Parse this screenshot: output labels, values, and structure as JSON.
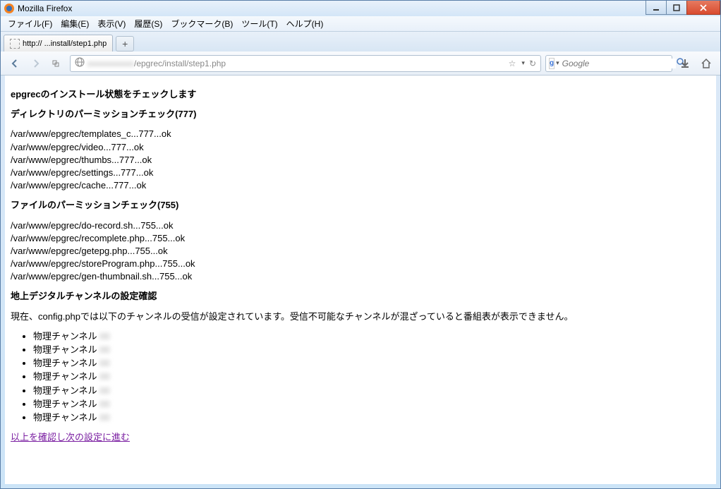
{
  "window": {
    "title": "Mozilla Firefox"
  },
  "menubar": {
    "items": [
      "ファイル(F)",
      "編集(E)",
      "表示(V)",
      "履歴(S)",
      "ブックマーク(B)",
      "ツール(T)",
      "ヘルプ(H)"
    ]
  },
  "tab": {
    "label": "http://            ...install/step1.php"
  },
  "urlbar": {
    "url_suffix": "/epgrec/install/step1.php",
    "star": "☆",
    "reload": "↻"
  },
  "searchbar": {
    "engine_letter": "g",
    "placeholder": "Google"
  },
  "page": {
    "title": "epgrecのインストール状態をチェックします",
    "section1": {
      "heading": "ディレクトリのパーミッションチェック(777)",
      "lines": [
        "/var/www/epgrec/templates_c...777...ok",
        "/var/www/epgrec/video...777...ok",
        "/var/www/epgrec/thumbs...777...ok",
        "/var/www/epgrec/settings...777...ok",
        "/var/www/epgrec/cache...777...ok"
      ]
    },
    "section2": {
      "heading": "ファイルのパーミッションチェック(755)",
      "lines": [
        "/var/www/epgrec/do-record.sh...755...ok",
        "/var/www/epgrec/recomplete.php...755...ok",
        "/var/www/epgrec/getepg.php...755...ok",
        "/var/www/epgrec/storeProgram.php...755...ok",
        "/var/www/epgrec/gen-thumbnail.sh...755...ok"
      ]
    },
    "section3": {
      "heading": "地上デジタルチャンネルの設定確認",
      "desc": "現在、config.phpでは以下のチャンネルの受信が設定されています。受信不可能なチャンネルが混ざっていると番組表が表示できません。",
      "channel_label": "物理チャンネル",
      "channel_count": 7
    },
    "next_link": "以上を確認し次の設定に進む"
  }
}
